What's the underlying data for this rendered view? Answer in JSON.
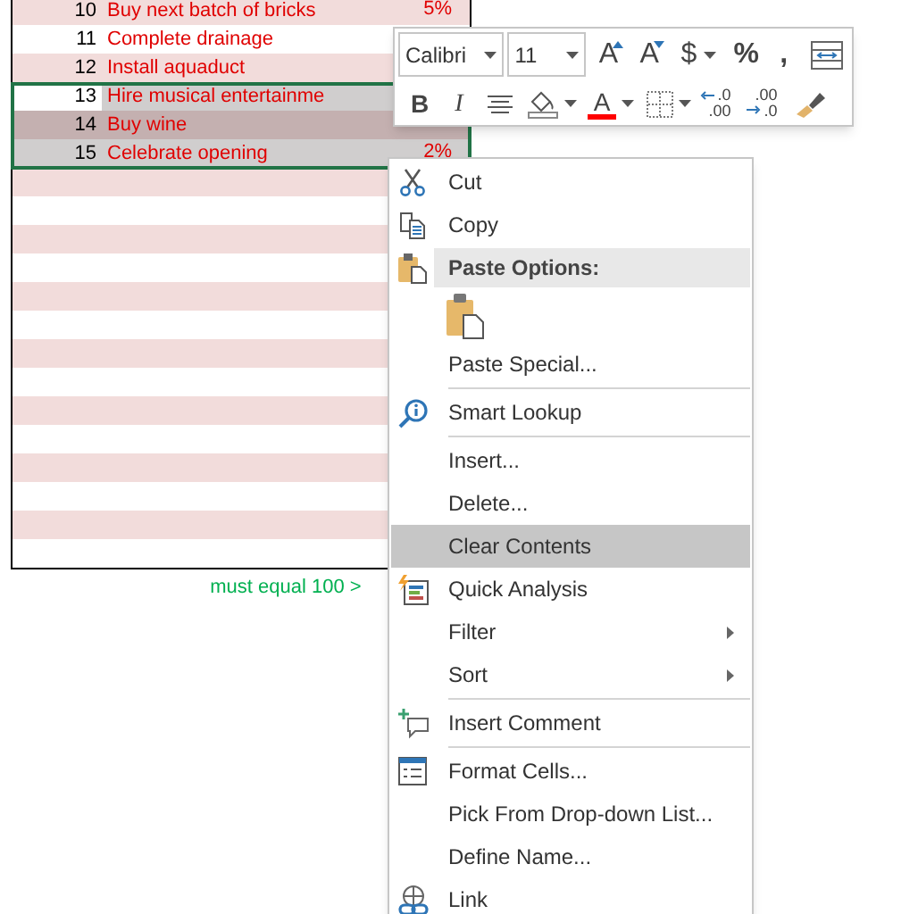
{
  "sheet": {
    "rows": [
      {
        "number": "10",
        "task": "Buy next batch of bricks",
        "percent": "5%",
        "selected": false
      },
      {
        "number": "11",
        "task": "Complete drainage",
        "selected": false
      },
      {
        "number": "12",
        "task": "Install aquaduct",
        "selected": false
      },
      {
        "number": "13",
        "task": "Hire musical entertainme",
        "selected": true
      },
      {
        "number": "14",
        "task": "Buy wine",
        "selected": true
      },
      {
        "number": "15",
        "task": "Celebrate opening",
        "percent": "2%",
        "selected": true
      }
    ],
    "note": "must equal 100 >"
  },
  "mini_toolbar": {
    "font": "Calibri",
    "size": "11",
    "row_1": [
      {
        "kind": "grow",
        "label": "A"
      },
      {
        "kind": "shrink",
        "label": "A"
      },
      {
        "kind": "currency",
        "label": "$"
      },
      {
        "kind": "percent",
        "label": "%"
      },
      {
        "kind": "comma",
        "label": ","
      },
      {
        "kind": "wrap"
      }
    ],
    "row_2": [
      {
        "kind": "bold",
        "label": "B"
      },
      {
        "kind": "italic",
        "label": "I"
      },
      {
        "kind": "align"
      },
      {
        "kind": "fill"
      },
      {
        "kind": "font-color",
        "label": "A"
      },
      {
        "kind": "borders"
      },
      {
        "kind": "increase-decimal",
        "lines": [
          ".0",
          ".00"
        ]
      },
      {
        "kind": "decrease-decimal",
        "lines": [
          ".00",
          ".0"
        ]
      },
      {
        "kind": "painter"
      }
    ]
  },
  "context_menu": {
    "items": [
      {
        "kind": "item",
        "label": "Cut",
        "selected": false
      },
      {
        "kind": "item",
        "label": "Copy",
        "selected": false
      },
      {
        "kind": "header",
        "label": "Paste Options:"
      },
      {
        "kind": "paste-option"
      },
      {
        "kind": "item",
        "label": "Paste Special...",
        "selected": false
      },
      {
        "kind": "separator"
      },
      {
        "kind": "item",
        "label": "Smart Lookup",
        "selected": false
      },
      {
        "kind": "separator"
      },
      {
        "kind": "item",
        "label": "Insert...",
        "selected": false
      },
      {
        "kind": "item",
        "label": "Delete...",
        "selected": false
      },
      {
        "kind": "item",
        "label": "Clear Contents",
        "selected": true
      },
      {
        "kind": "item",
        "label": "Quick Analysis",
        "selected": false
      },
      {
        "kind": "item",
        "label": "Filter",
        "submenu": true,
        "selected": false
      },
      {
        "kind": "item",
        "label": "Sort",
        "submenu": true,
        "selected": false
      },
      {
        "kind": "separator"
      },
      {
        "kind": "item",
        "label": "Insert Comment",
        "selected": false
      },
      {
        "kind": "separator"
      },
      {
        "kind": "item",
        "label": "Format Cells...",
        "selected": false
      },
      {
        "kind": "item",
        "label": "Pick From Drop-down List...",
        "selected": false
      },
      {
        "kind": "item",
        "label": "Define Name...",
        "selected": false
      },
      {
        "kind": "item",
        "label": "Link",
        "selected": false
      }
    ]
  }
}
